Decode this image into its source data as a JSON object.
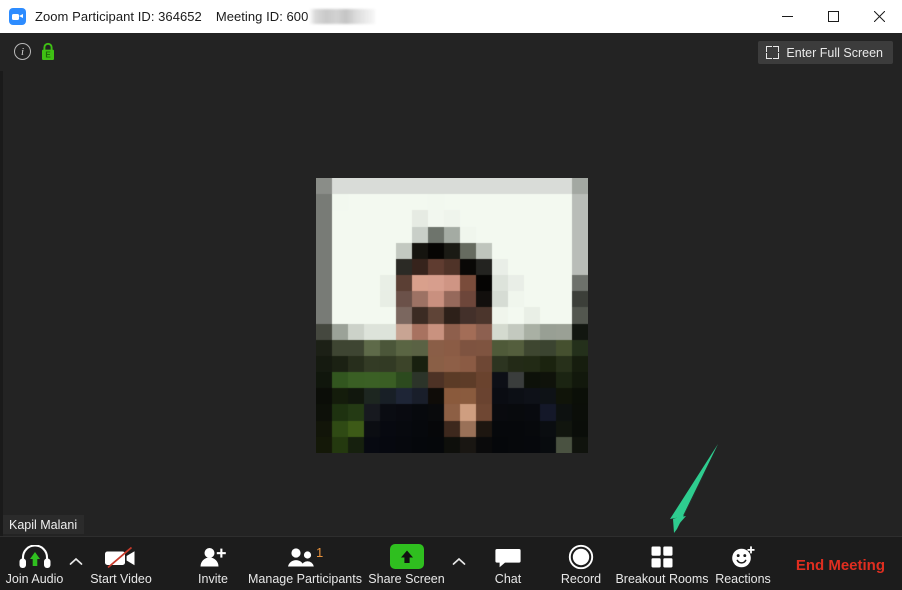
{
  "window": {
    "title_participant": "Zoom Participant ID: 364652",
    "title_meeting": "Meeting ID: 600",
    "app_icon": "zoom-camera-icon",
    "controls": [
      {
        "name": "minimize",
        "glyph": "minimize-icon"
      },
      {
        "name": "maximize",
        "glyph": "maximize-icon"
      },
      {
        "name": "close",
        "glyph": "close-icon"
      }
    ]
  },
  "topbar": {
    "info_icon": "info-icon",
    "info_glyph": "i",
    "lock_icon": "encryption-lock-icon",
    "lock_letter": "E",
    "fullscreen_label": "Enter Full Screen",
    "fullscreen_icon": "expand-corners-icon"
  },
  "stage": {
    "participant_name": "Kapil Malani",
    "annotation_arrow": {
      "icon": "green-arrow-pointing-down-left",
      "color": "#2ECC8F",
      "points_to": "Breakout Rooms"
    },
    "video_alt": "pixelated participant video"
  },
  "toolbar": {
    "items": [
      {
        "label": "Join Audio",
        "icon": "headset-join-audio-icon",
        "caret": true,
        "badge": null
      },
      {
        "label": "Start Video",
        "icon": "camera-off-icon",
        "caret": false,
        "badge": null
      },
      {
        "label": "Invite",
        "icon": "add-person-icon",
        "caret": false,
        "badge": null
      },
      {
        "label": "Manage Participants",
        "icon": "participants-icon",
        "caret": false,
        "badge": "1"
      },
      {
        "label": "Share Screen",
        "icon": "share-screen-up-arrow-icon",
        "caret": true,
        "badge": null
      },
      {
        "label": "Chat",
        "icon": "speech-bubble-icon",
        "caret": false,
        "badge": null
      },
      {
        "label": "Record",
        "icon": "record-circle-icon",
        "caret": false,
        "badge": null
      },
      {
        "label": "Breakout Rooms",
        "icon": "grid-squares-icon",
        "caret": false,
        "badge": null
      },
      {
        "label": "Reactions",
        "icon": "smiley-plus-icon",
        "caret": false,
        "badge": null
      }
    ],
    "end_meeting_label": "End Meeting"
  },
  "colors": {
    "window_bg": "#232323",
    "toolbar_bg": "#1c1c1c",
    "accent_green": "#2fbf1f",
    "badge_orange": "#e8923c",
    "end_red": "#e02e20",
    "lock_green": "#3fc014",
    "arrow_green": "#2ECC8F"
  }
}
